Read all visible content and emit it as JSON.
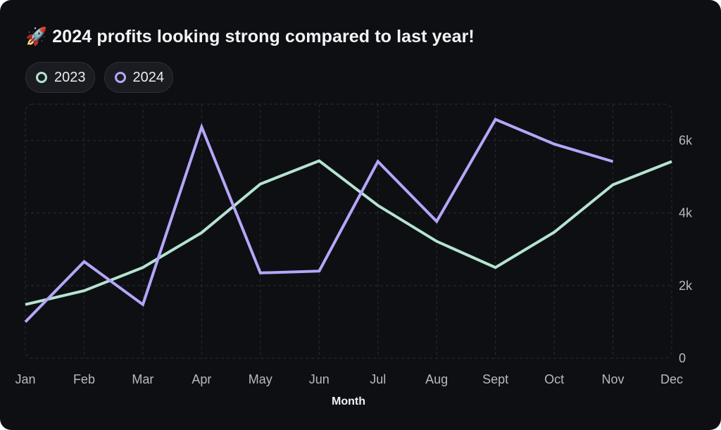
{
  "card": {
    "title_emoji": "🚀",
    "title": "2024 profits looking strong compared to last year!"
  },
  "legend": [
    {
      "label": "2023",
      "color": "#b4e4cf"
    },
    {
      "label": "2024",
      "color": "#b6a6fb"
    }
  ],
  "chart_data": {
    "type": "line",
    "title": "2024 profits looking strong compared to last year!",
    "xlabel": "Month",
    "ylabel": "",
    "categories": [
      "Jan",
      "Feb",
      "Mar",
      "Apr",
      "May",
      "Jun",
      "Jul",
      "Aug",
      "Sept",
      "Oct",
      "Nov",
      "Dec"
    ],
    "y_ticks": [
      0,
      2000,
      4000,
      6000
    ],
    "y_tick_labels": [
      "0",
      "2k",
      "4k",
      "6k"
    ],
    "ylim": [
      0,
      7000
    ],
    "grid": true,
    "y_axis_side": "right",
    "legend_position": "top-left",
    "series": [
      {
        "name": "2023",
        "color": "#b4e4cf",
        "values": [
          1480,
          1860,
          2500,
          3460,
          4800,
          5440,
          4210,
          3220,
          2500,
          3470,
          4780,
          5420
        ]
      },
      {
        "name": "2024",
        "color": "#b6a6fb",
        "values": [
          1000,
          2660,
          1480,
          6370,
          2350,
          2400,
          5420,
          3770,
          6580,
          5900,
          5420,
          null
        ]
      }
    ]
  }
}
